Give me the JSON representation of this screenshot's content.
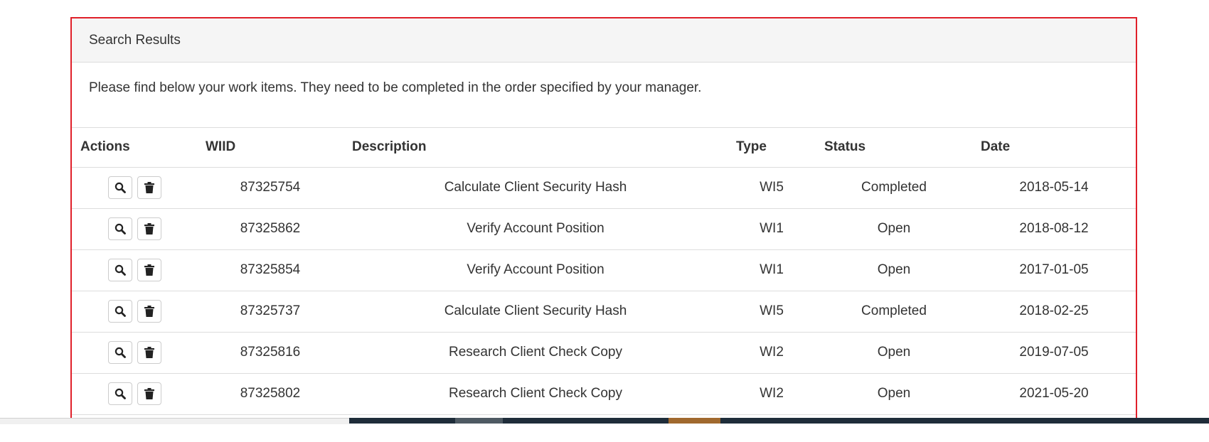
{
  "panel": {
    "heading": "Search Results",
    "description": "Please find below your work items. They need to be completed in the order specified by your manager.",
    "border_color": "#e0202a"
  },
  "table": {
    "headers": {
      "actions": "Actions",
      "wiid": "WIID",
      "description": "Description",
      "type": "Type",
      "status": "Status",
      "date": "Date"
    },
    "rows": [
      {
        "wiid": "87325754",
        "description": "Calculate Client Security Hash",
        "type": "WI5",
        "status": "Completed",
        "date": "2018-05-14"
      },
      {
        "wiid": "87325862",
        "description": "Verify Account Position",
        "type": "WI1",
        "status": "Open",
        "date": "2018-08-12"
      },
      {
        "wiid": "87325854",
        "description": "Verify Account Position",
        "type": "WI1",
        "status": "Open",
        "date": "2017-01-05"
      },
      {
        "wiid": "87325737",
        "description": "Calculate Client Security Hash",
        "type": "WI5",
        "status": "Completed",
        "date": "2018-02-25"
      },
      {
        "wiid": "87325816",
        "description": "Research Client Check Copy",
        "type": "WI2",
        "status": "Open",
        "date": "2019-07-05"
      },
      {
        "wiid": "87325802",
        "description": "Research Client Check Copy",
        "type": "WI2",
        "status": "Open",
        "date": "2021-05-20"
      }
    ],
    "row_actions": {
      "view_icon": "search-icon",
      "delete_icon": "trash-icon"
    }
  }
}
